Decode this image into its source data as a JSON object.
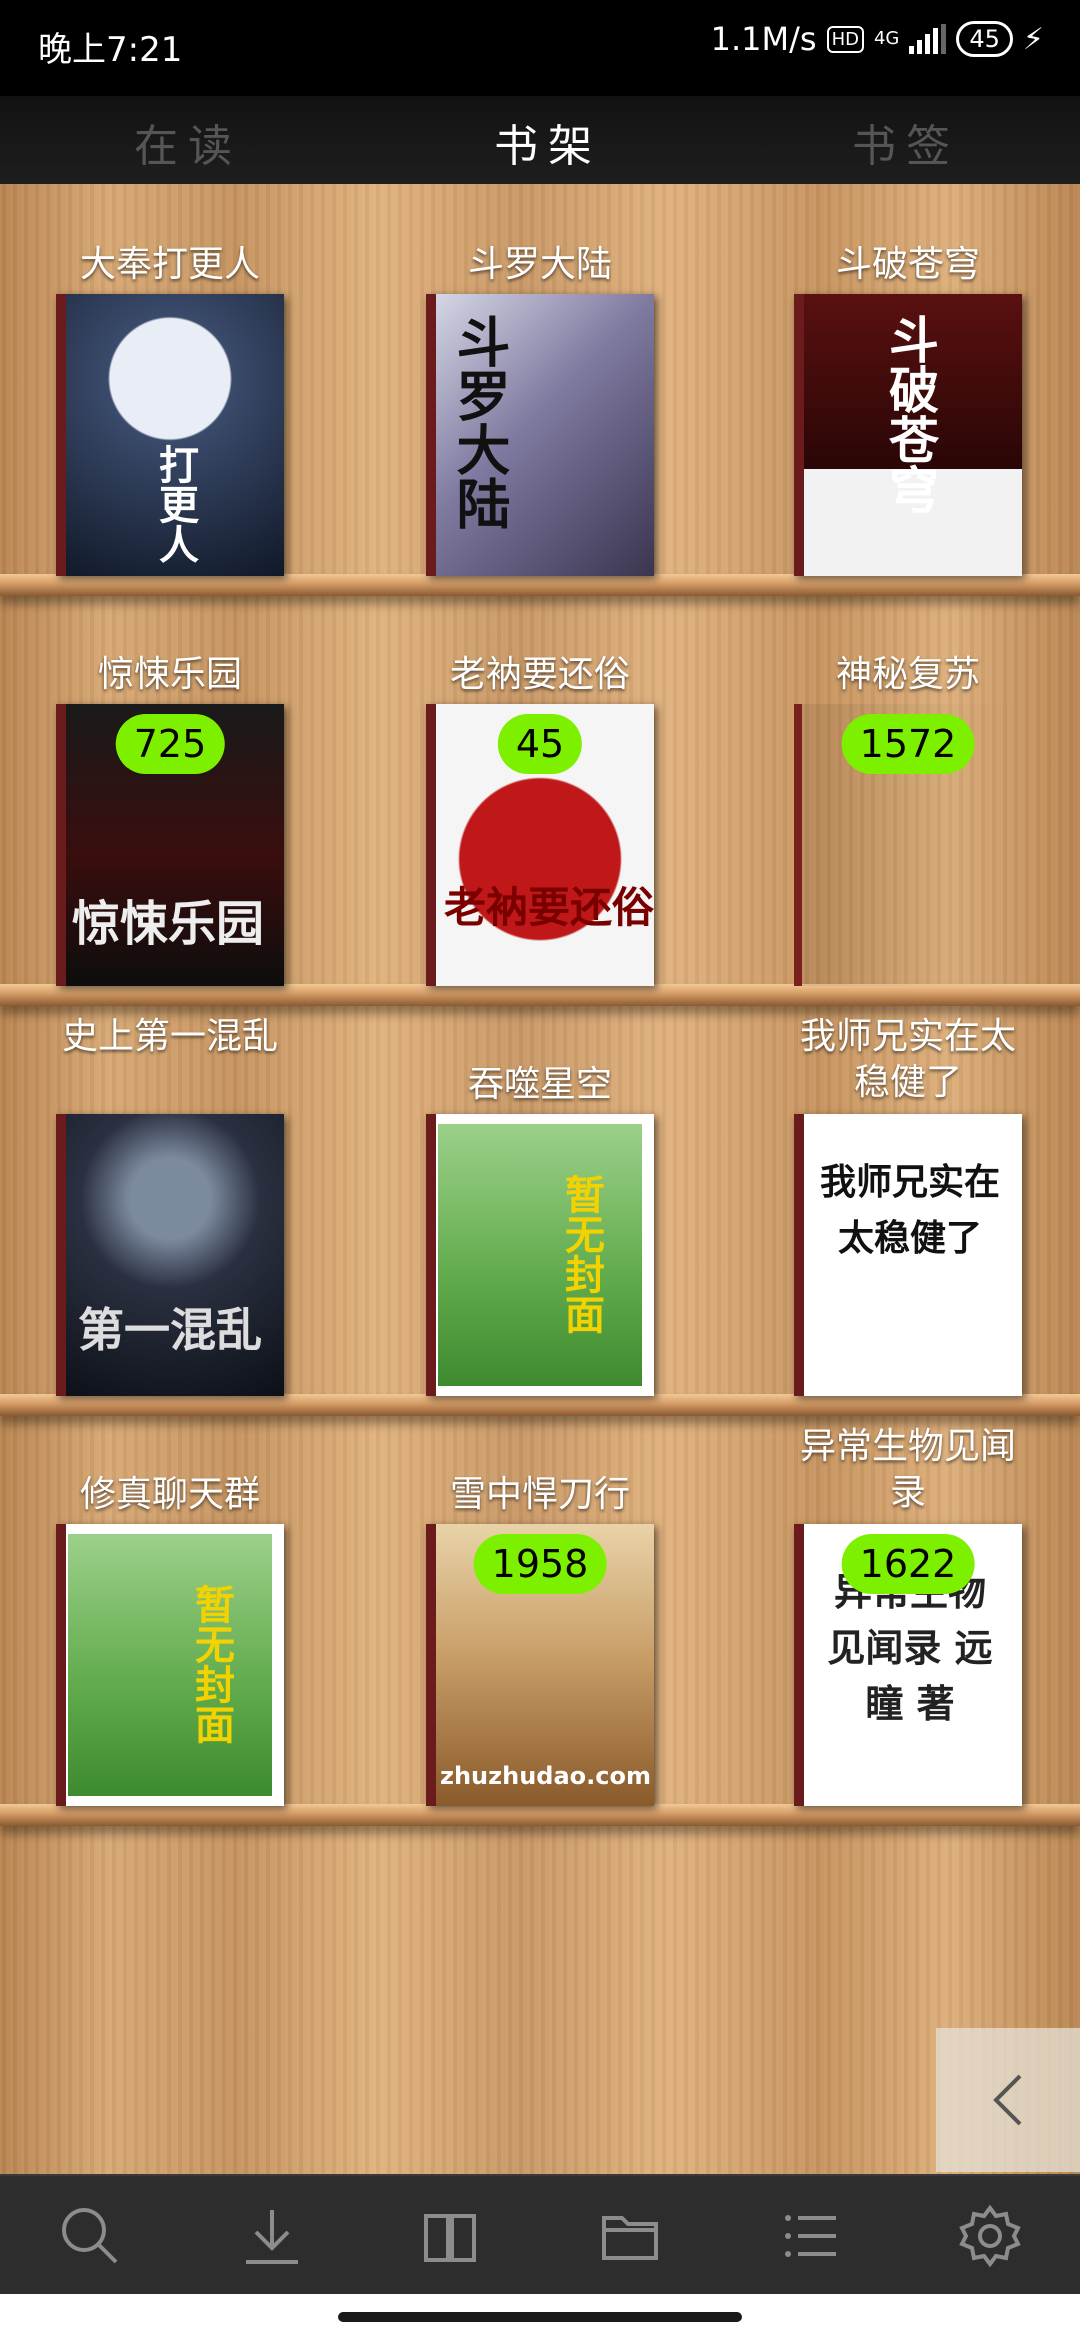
{
  "status": {
    "time": "晚上7:21",
    "speed": "1.1M/s",
    "hd": "HD",
    "network": "4G",
    "battery": "45",
    "charging_icon": "bolt-icon"
  },
  "tabs": {
    "reading": "在读",
    "shelf": "书架",
    "bookmark": "书签"
  },
  "books": [
    {
      "title": "大奉打更人",
      "cover_text": "打更人",
      "badge": ""
    },
    {
      "title": "斗罗大陆",
      "cover_text": "斗罗大陆",
      "badge": ""
    },
    {
      "title": "斗破苍穹",
      "cover_text": "斗破苍穹",
      "badge": ""
    },
    {
      "title": "惊悚乐园",
      "cover_text": "惊悚乐园",
      "badge": "725"
    },
    {
      "title": "老衲要还俗",
      "cover_text": "老衲要还俗",
      "badge": "45"
    },
    {
      "title": "神秘复苏",
      "cover_text": "",
      "badge": "1572"
    },
    {
      "title": "史上第一混乱",
      "cover_text": "第一混乱",
      "badge": ""
    },
    {
      "title": "吞噬星空",
      "cover_text": "暂无封面",
      "badge": ""
    },
    {
      "title": "我师兄实在太稳健了",
      "cover_text": "我师兄实在 太稳健了",
      "badge": ""
    },
    {
      "title": "修真聊天群",
      "cover_text": "暂无封面",
      "badge": ""
    },
    {
      "title": "雪中悍刀行",
      "cover_text": "zhuzhudao.com",
      "badge": "1958"
    },
    {
      "title": "异常生物见闻录",
      "cover_text": "异常生物 见闻录 远瞳 著",
      "badge": "1622"
    }
  ],
  "bottom_nav": [
    "search-icon",
    "download-icon",
    "book-icon",
    "folder-icon",
    "list-icon",
    "gear-icon"
  ],
  "side_toggle_icon": "chevron-left-icon"
}
